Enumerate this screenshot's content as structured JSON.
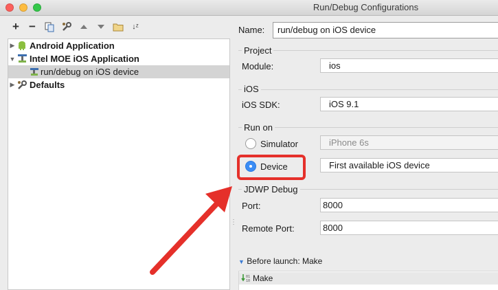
{
  "window": {
    "title": "Run/Debug Configurations"
  },
  "toolbar": {
    "add": "+",
    "remove": "−",
    "sort": "↓ᶻ"
  },
  "tree": {
    "items": [
      {
        "label": "Android Application"
      },
      {
        "label": "Intel MOE iOS Application"
      },
      {
        "label": "run/debug on iOS device"
      },
      {
        "label": "Defaults"
      }
    ]
  },
  "form": {
    "name_label": "Name:",
    "name_value": "run/debug on iOS device",
    "project": {
      "title": "Project",
      "module_label": "Module:",
      "module_value": "ios"
    },
    "ios": {
      "title": "iOS",
      "sdk_label": "iOS SDK:",
      "sdk_value": "iOS 9.1"
    },
    "run_on": {
      "title": "Run on",
      "simulator_label": "Simulator",
      "simulator_value": "iPhone 6s",
      "device_label": "Device",
      "device_value": "First available iOS device",
      "selected": "Device"
    },
    "jdwp": {
      "title": "JDWP Debug",
      "port_label": "Port:",
      "port_value": "8000",
      "remote_port_label": "Remote Port:",
      "remote_port_value": "8000"
    },
    "before_launch": {
      "title": "Before launch: Make",
      "item": "Make"
    }
  },
  "colors": {
    "highlight": "#e5302a",
    "radio_selected": "#3b8df5",
    "selection": "#d4d4d4"
  }
}
